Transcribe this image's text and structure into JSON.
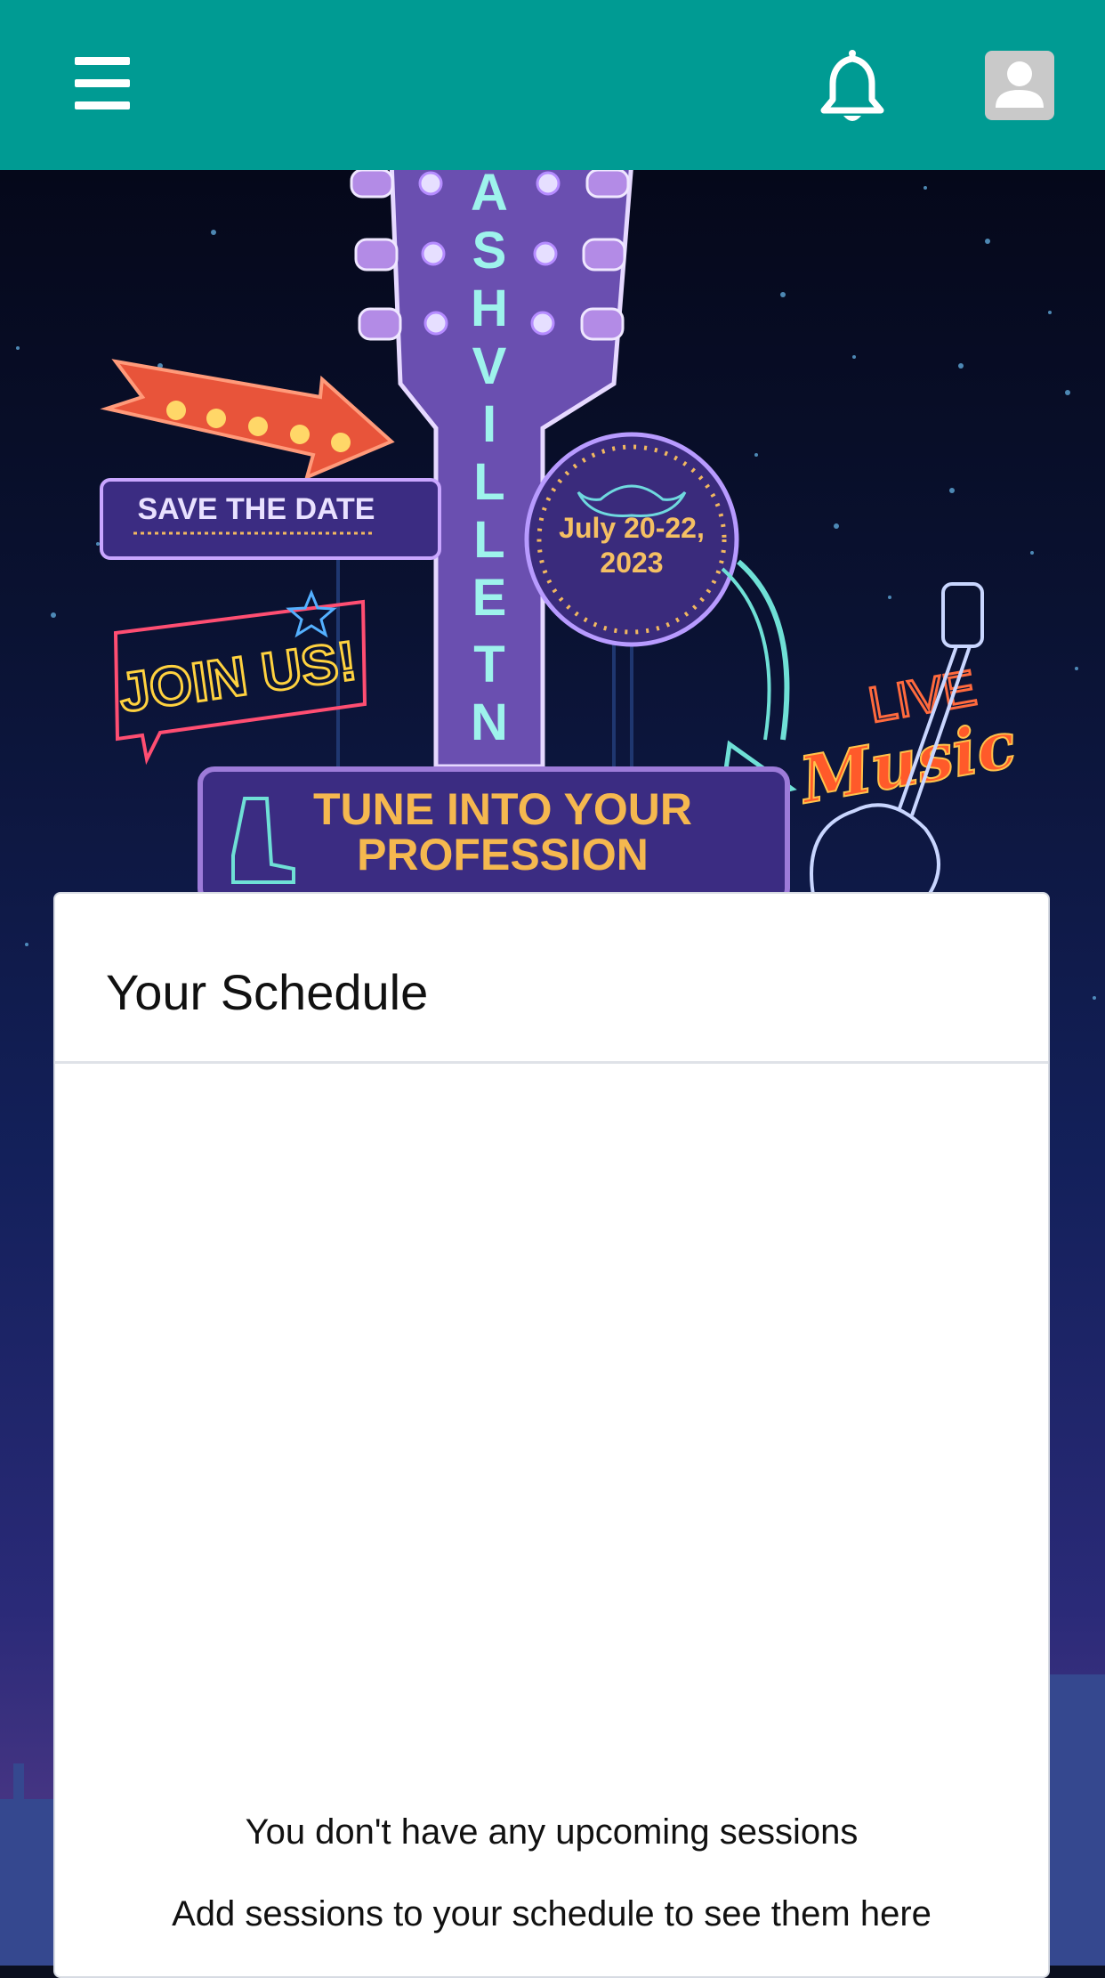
{
  "header": {
    "menu_icon": "hamburger-menu-icon",
    "notifications_icon": "bell-icon",
    "profile_icon": "user-avatar-icon",
    "color": "#009b93"
  },
  "banner": {
    "city_letters": [
      "A",
      "S",
      "H",
      "V",
      "I",
      "L",
      "L",
      "E",
      "T",
      "N"
    ],
    "save_the_date": "SAVE THE DATE",
    "date_line1": "July 20-22,",
    "date_line2": "2023",
    "join_us": "JOIN US!",
    "live": "LIVE",
    "music": "Music",
    "tagline_line1": "TUNE INTO YOUR",
    "tagline_line2": "PROFESSION"
  },
  "schedule": {
    "title": "Your Schedule",
    "empty_title": "You don't have any upcoming sessions",
    "empty_hint": "Add sessions to your schedule to see them here"
  }
}
